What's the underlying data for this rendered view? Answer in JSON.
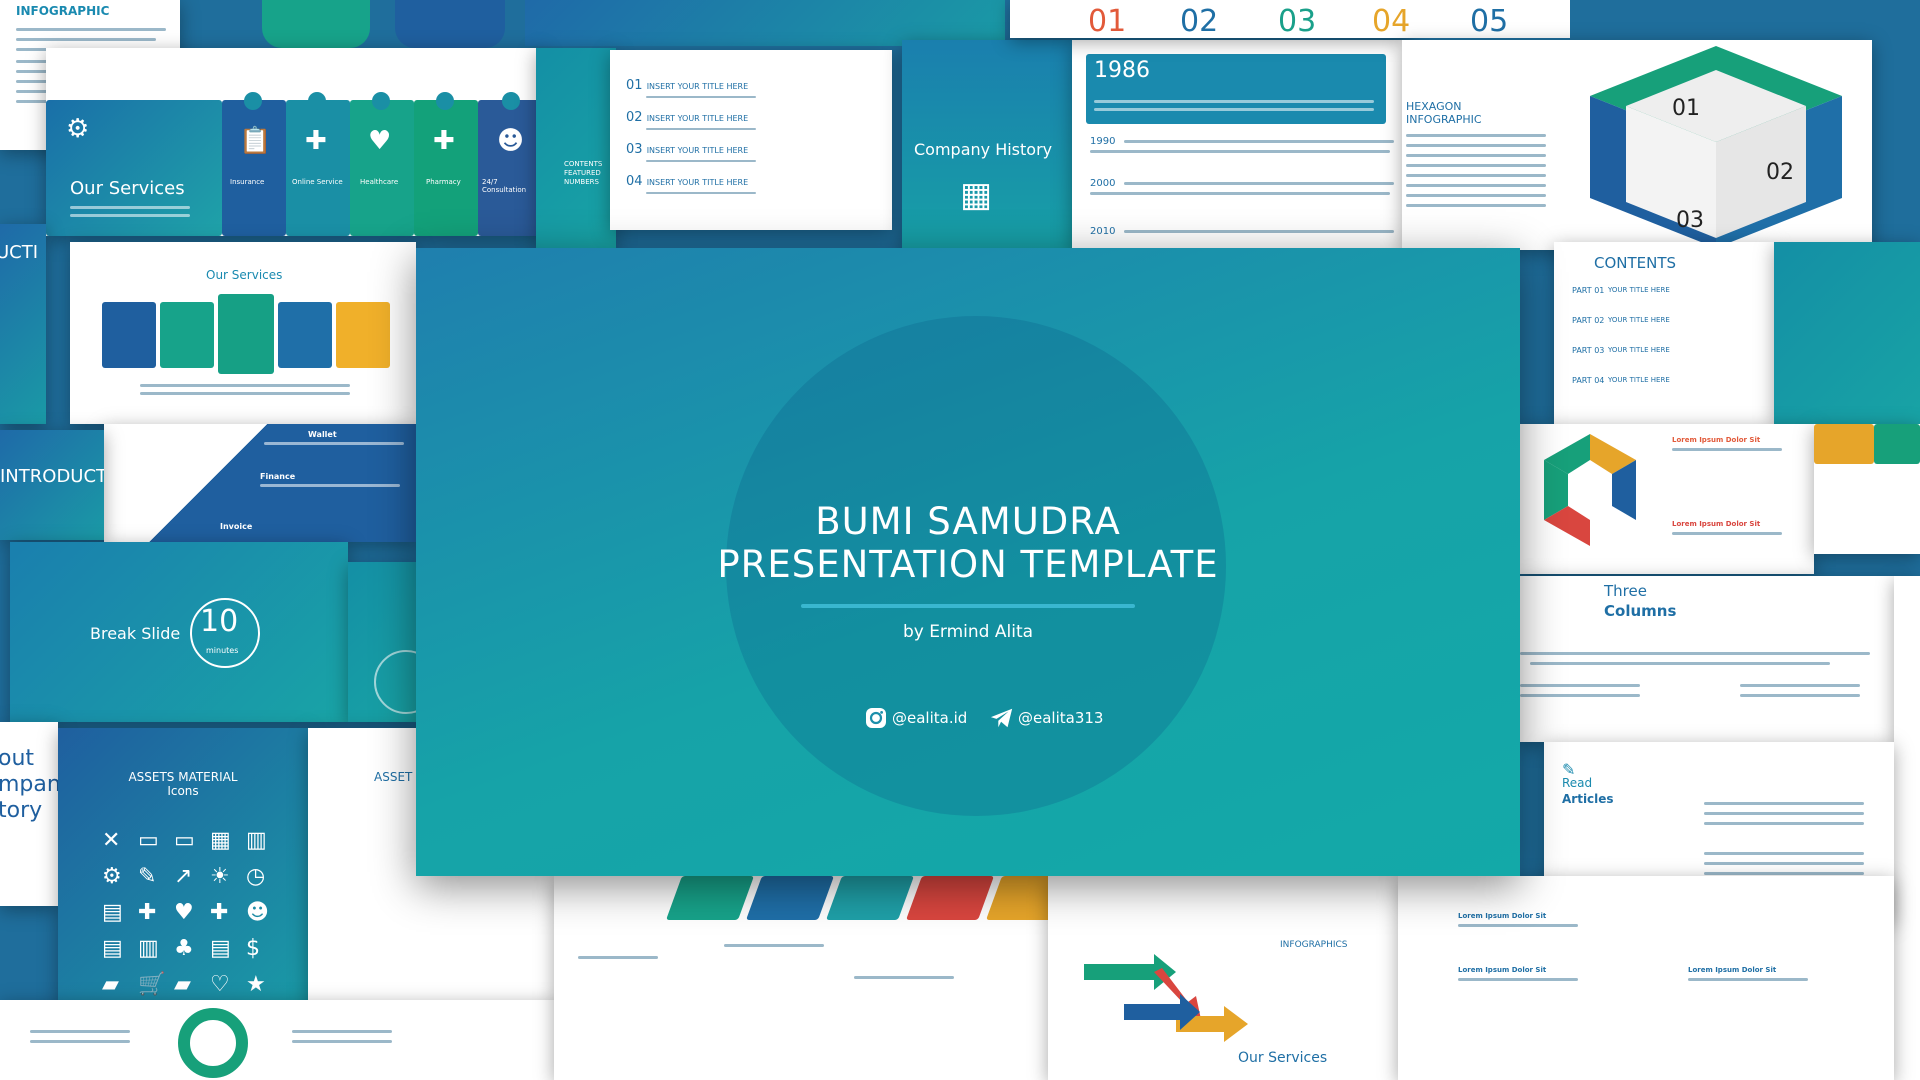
{
  "main_slide": {
    "title_line1": "BUMI SAMUDRA",
    "title_line2": "PRESENTATION TEMPLATE",
    "author": "by Ermind Alita",
    "social": [
      {
        "icon": "instagram-icon",
        "handle": "@ealita.id"
      },
      {
        "icon": "telegram-icon",
        "handle": "@ealita313"
      }
    ],
    "colors": {
      "gradient_start": "#1f7fae",
      "gradient_end": "#13a9a8",
      "divider": "#39b7d0"
    }
  },
  "background_slides": {
    "infographic": {
      "title": "INFOGRAPHIC"
    },
    "our_services_top": {
      "title": "Our Services",
      "items": [
        "Insurance",
        "Online Service",
        "Healthcare",
        "Pharmacy",
        "24/7 Consultation"
      ]
    },
    "contents_list": {
      "side_label": "CONTENTS\nFEATURED\nNUMBERS",
      "items": [
        {
          "num": "01",
          "text": "INSERT YOUR TITLE HERE"
        },
        {
          "num": "02",
          "text": "INSERT YOUR TITLE HERE"
        },
        {
          "num": "03",
          "text": "INSERT YOUR TITLE HERE"
        },
        {
          "num": "04",
          "text": "INSERT YOUR TITLE HERE"
        }
      ]
    },
    "company_history": {
      "title": "Company History",
      "year_main": "1986",
      "years": [
        "1990",
        "2000",
        "2010"
      ]
    },
    "hexagon": {
      "title": "HEXAGON\nINFOGRAPHIC",
      "numbers": [
        "01",
        "02",
        "03"
      ]
    },
    "numbers_top": [
      "01",
      "02",
      "03",
      "04",
      "05"
    ],
    "contents_right": {
      "title": "CONTENTS",
      "parts": [
        {
          "label": "PART\n01",
          "text": "YOUR TITLE HERE"
        },
        {
          "label": "PART\n02",
          "text": "YOUR TITLE HERE"
        },
        {
          "label": "PART\n03",
          "text": "YOUR TITLE HERE"
        },
        {
          "label": "PART\n04",
          "text": "YOUR TITLE HERE"
        }
      ]
    },
    "our_services_mid": {
      "title": "Our Services"
    },
    "finance": {
      "items": [
        "Wallet",
        "Finance",
        "Invoice"
      ]
    },
    "introduction": {
      "title": "INTRODUCTIO"
    },
    "break_slide": {
      "label": "Break Slide",
      "number": "10",
      "unit": "minutes"
    },
    "assets": {
      "title": "ASSETS MATERIAL\nIcons",
      "title2": "ASSET"
    },
    "three_columns": {
      "line1": "Three",
      "line2": "Columns"
    },
    "read_articles": {
      "line1": "Read",
      "line2": "Articles"
    },
    "lorem_label": "Lorem Ipsum Dolor Sit",
    "bottom_services": "Our Services",
    "infographics_small": "INFOGRAPHICS",
    "about": "out\nmpan\ntory"
  }
}
